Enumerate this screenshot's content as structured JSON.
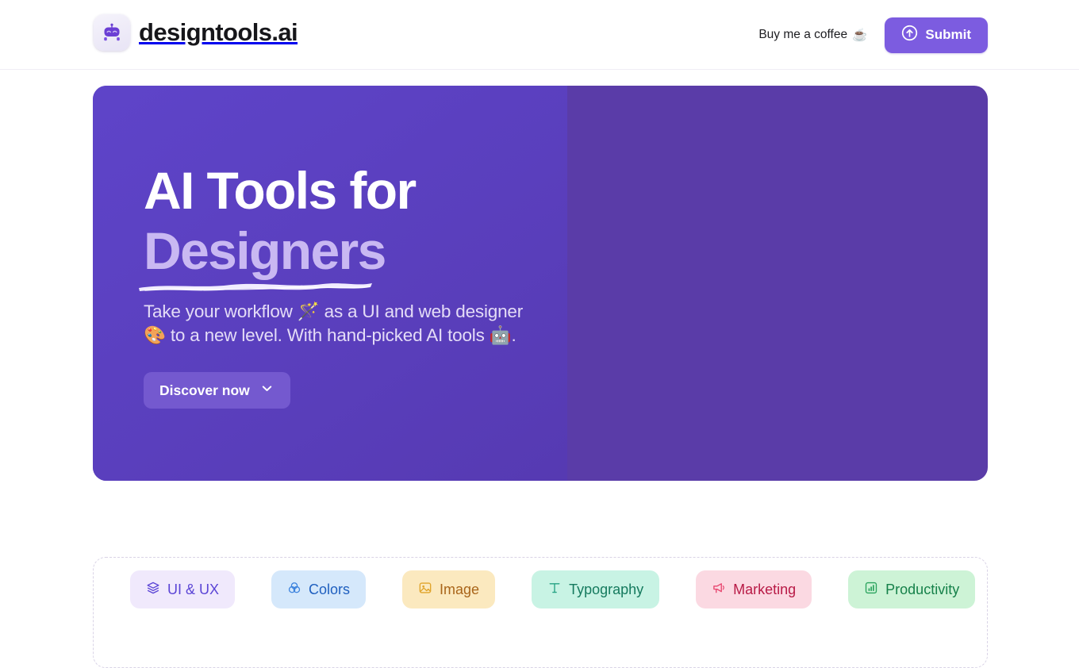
{
  "header": {
    "brand_name": "designtools.ai",
    "logo_icon": "robot-logo-icon",
    "coffee_label": "Buy me a coffee",
    "coffee_emoji": "☕",
    "submit_label": "Submit",
    "submit_icon": "arrow-up-circle-icon",
    "accent_color": "#7c5ce0"
  },
  "hero": {
    "title_line1": "AI Tools for",
    "title_accent": "Designers",
    "subtitle": "Take your workflow 🪄 as a UI and web designer 🎨 to a new level. With hand-picked AI tools 🤖.",
    "cta_label": "Discover now",
    "cta_icon": "chevron-down-icon",
    "bg_left_color": "#5e44c9",
    "bg_right_color": "#5a3ca8",
    "accent_text_color": "#c9b8f2"
  },
  "categories": {
    "items": [
      {
        "label": "UI & UX",
        "icon": "layers-icon",
        "class": "chip-uiux",
        "bg": "#f0e9fc",
        "fg": "#5b45d6"
      },
      {
        "label": "Colors",
        "icon": "circles-icon",
        "class": "chip-colors",
        "bg": "#d5e8fb",
        "fg": "#1f5fbf"
      },
      {
        "label": "Image",
        "icon": "image-icon",
        "class": "chip-image",
        "bg": "#fbe9bf",
        "fg": "#a9651a"
      },
      {
        "label": "Typography",
        "icon": "type-t-icon",
        "class": "chip-typography",
        "bg": "#c8f3e4",
        "fg": "#157a5e"
      },
      {
        "label": "Marketing",
        "icon": "megaphone-icon",
        "class": "chip-marketing",
        "bg": "#fbd9e2",
        "fg": "#b81a46"
      },
      {
        "label": "Productivity",
        "icon": "bar-chart-icon",
        "class": "chip-productivity",
        "bg": "#cdf3d6",
        "fg": "#16814a"
      }
    ]
  }
}
